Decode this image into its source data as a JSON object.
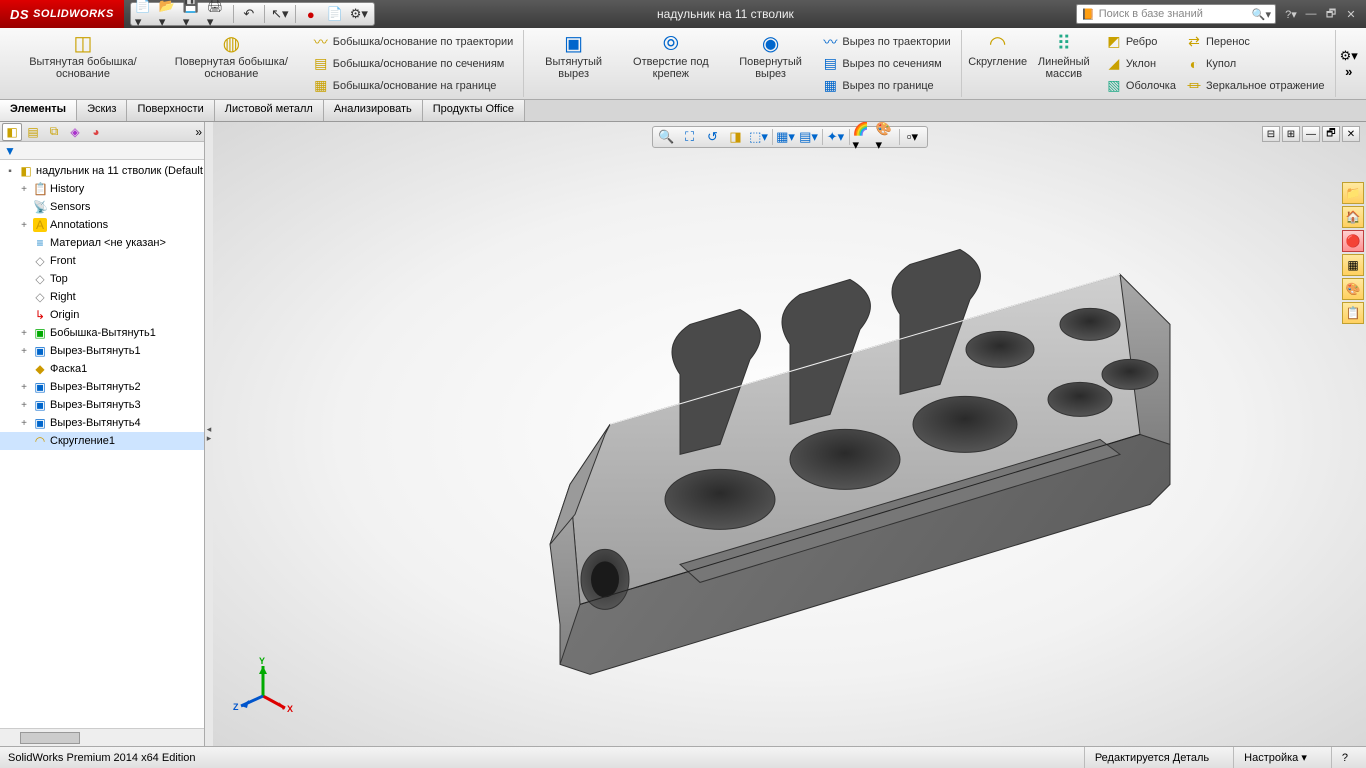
{
  "app": {
    "logo_prefix": "DS",
    "logo_text": "SOLIDWORKS",
    "document_title": "надульник  на 11 стволик",
    "search_placeholder": "Поиск в базе знаний"
  },
  "ribbon": {
    "groups": [
      {
        "big": [
          {
            "icon": "◫",
            "label": "Вытянутая бобышка/основание",
            "color": "#c9a100"
          },
          {
            "icon": "◍",
            "label": "Повернутая бобышка/основание",
            "color": "#c9a100"
          }
        ],
        "small": [
          {
            "icon": "〰",
            "label": "Бобышка/основание по траектории"
          },
          {
            "icon": "▤",
            "label": "Бобышка/основание по сечениям"
          },
          {
            "icon": "▦",
            "label": "Бобышка/основание на границе"
          }
        ]
      },
      {
        "big": [
          {
            "icon": "▣",
            "label": "Вытянутый вырез",
            "color": "#0066cc"
          },
          {
            "icon": "⦾",
            "label": "Отверстие под крепеж",
            "color": "#0066cc"
          },
          {
            "icon": "◉",
            "label": "Повернутый вырез",
            "color": "#0066cc"
          }
        ],
        "small": [
          {
            "icon": "〰",
            "label": "Вырез по траектории"
          },
          {
            "icon": "▤",
            "label": "Вырез по сечениям"
          },
          {
            "icon": "▦",
            "label": "Вырез по границе"
          }
        ]
      },
      {
        "big": [
          {
            "icon": "◠",
            "label": "Скругление",
            "color": "#c9a100"
          },
          {
            "icon": "⠿",
            "label": "Линейный массив",
            "color": "#2a8"
          }
        ],
        "small": [
          {
            "icon": "◩",
            "label": "Ребро"
          },
          {
            "icon": "◢",
            "label": "Уклон"
          },
          {
            "icon": "▧",
            "label": "Оболочка"
          }
        ],
        "small2": [
          {
            "icon": "⇄",
            "label": "Перенос"
          },
          {
            "icon": "◐",
            "label": "Купол"
          },
          {
            "icon": "⏛",
            "label": "Зеркальное отражение"
          }
        ]
      }
    ]
  },
  "tabs": [
    "Элементы",
    "Эскиз",
    "Поверхности",
    "Листовой металл",
    "Анализировать",
    "Продукты Office"
  ],
  "active_tab": 0,
  "tree": {
    "root": "надульник  на 11 стволик  (Default",
    "items": [
      {
        "exp": "+",
        "icon": "📋",
        "label": "History",
        "color": "#c90"
      },
      {
        "exp": "",
        "icon": "📡",
        "label": "Sensors",
        "color": "#c90"
      },
      {
        "exp": "+",
        "icon": "A",
        "label": "Annotations",
        "color": "#c90",
        "iconbg": "#ffcc00"
      },
      {
        "exp": "",
        "icon": "≡",
        "label": "Материал <не указан>",
        "color": "#28c"
      },
      {
        "exp": "",
        "icon": "◇",
        "label": "Front",
        "color": "#888"
      },
      {
        "exp": "",
        "icon": "◇",
        "label": "Top",
        "color": "#888"
      },
      {
        "exp": "",
        "icon": "◇",
        "label": "Right",
        "color": "#888"
      },
      {
        "exp": "",
        "icon": "↳",
        "label": "Origin",
        "color": "#d00"
      },
      {
        "exp": "+",
        "icon": "▣",
        "label": "Бобышка-Вытянуть1",
        "color": "#0a0"
      },
      {
        "exp": "+",
        "icon": "▣",
        "label": "Вырез-Вытянуть1",
        "color": "#06c"
      },
      {
        "exp": "",
        "icon": "◆",
        "label": "Фаска1",
        "color": "#c90"
      },
      {
        "exp": "+",
        "icon": "▣",
        "label": "Вырез-Вытянуть2",
        "color": "#06c"
      },
      {
        "exp": "+",
        "icon": "▣",
        "label": "Вырез-Вытянуть3",
        "color": "#06c"
      },
      {
        "exp": "+",
        "icon": "▣",
        "label": "Вырез-Вытянуть4",
        "color": "#06c"
      },
      {
        "exp": "",
        "icon": "◠",
        "label": "Скругление1",
        "color": "#c90",
        "sel": true
      }
    ]
  },
  "status": {
    "edition": "SolidWorks Premium 2014 x64 Edition",
    "state": "Редактируется Деталь",
    "custom": "Настройка"
  },
  "triad": {
    "x": "X",
    "y": "Y",
    "z": "Z"
  }
}
